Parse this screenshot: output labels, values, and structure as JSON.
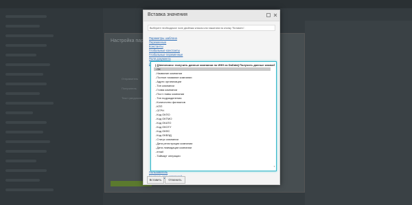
{
  "dialog": {
    "title": "Вставка значения",
    "instruction": "Выберите необходимое поле двойным кликом или нажатием на кнопку \"Вставить\".",
    "links_top": [
      "Параметры шаблона",
      "Переменные",
      "Константы",
      "Глобальные константы",
      "Глобальные переменные",
      "Поля документа",
      "Дополнительные результаты"
    ],
    "tree_items": [
      "[Автопоиск: получить данные компании по ИНН из DaData] Получить данные компан",
      "ОК",
      "Название компании",
      "Полное название компании",
      "Адрес организации",
      "Тип компании",
      "Глава компании",
      "Пост главы компании",
      "Тип подразделения",
      "Количество филиалов",
      "КПП",
      "ОГРН",
      "Код ОКПО",
      "Код ОКТМО",
      "Код ОКАТО",
      "Код ОКОГУ",
      "Код ОКФС",
      "Код ОКВЭД",
      "Статус компании",
      "Дата регистрации компании",
      "Дата ликвидации компании",
      "email",
      "Таймаут операции"
    ],
    "links_bottom": [
      "Пользователь",
      "Контроль пользователей"
    ],
    "insert_button": "Вставить",
    "cancel_button": "Отменить"
  },
  "background": {
    "panel_title": "Настройка пара",
    "panel_labels": [
      "Отправитель",
      "Получатель",
      "Текст уведомления"
    ]
  }
}
